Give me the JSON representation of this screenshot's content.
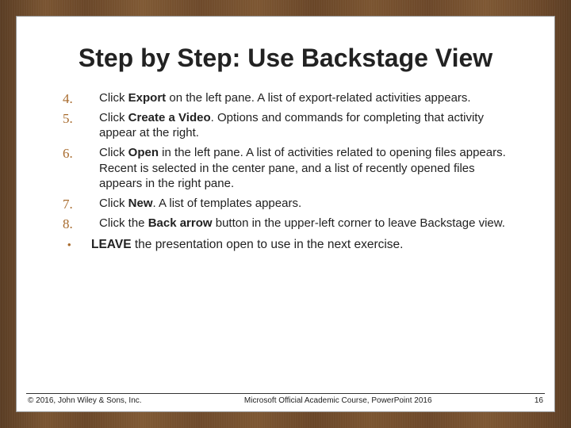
{
  "title": "Step by Step: Use Backstage View",
  "steps": [
    {
      "n": "4.",
      "html": "Click <b>Export</b> on the left pane. A list of export-related activities appears."
    },
    {
      "n": "5.",
      "html": "Click <b>Create a Video</b>. Options and commands for completing that activity appear at the right."
    },
    {
      "n": "6.",
      "html": "Click <b>Open</b> in the left pane. A list of activities related to opening files appears. Recent is selected in the center pane, and a list of recently opened files appears in the right pane."
    },
    {
      "n": "7.",
      "html": "Click <b>New</b>. A list of templates appears."
    },
    {
      "n": "8.",
      "html": "Click the <b>Back arrow</b> button in the upper-left corner to leave Backstage view."
    }
  ],
  "leave_html": "<b>LEAVE</b> the presentation open to use in the next exercise.",
  "footer": {
    "copyright": "© 2016, John Wiley & Sons, Inc.",
    "course": "Microsoft Official Academic Course, PowerPoint 2016",
    "page": "16"
  }
}
